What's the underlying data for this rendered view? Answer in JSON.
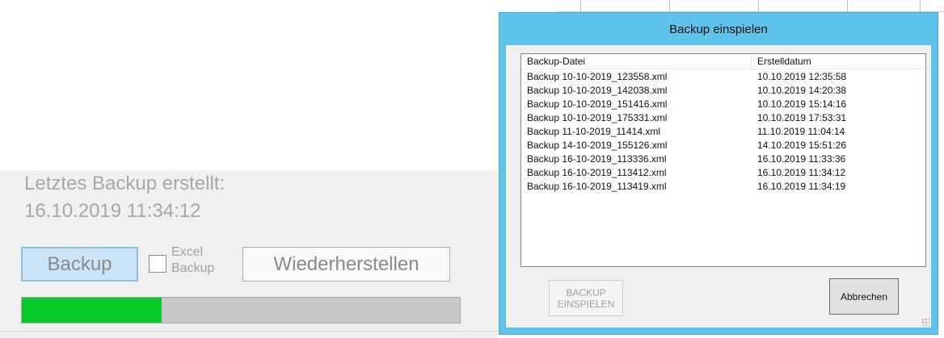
{
  "main": {
    "last_backup_label": "Letztes Backup erstellt:",
    "last_backup_time": "16.10.2019 11:34:12",
    "backup_button": "Backup",
    "excel_label": "Excel\nBackup",
    "excel_checked": false,
    "restore_button": "Wiederherstellen",
    "progress": 0.32,
    "progress_color": "#06cc2b"
  },
  "dialog": {
    "title": "Backup einspielen",
    "columns": [
      "Backup-Datei",
      "Erstelldatum"
    ],
    "rows": [
      {
        "file": "Backup 10-10-2019_123558.xml",
        "date": "10.10.2019 12:35:58"
      },
      {
        "file": "Backup 10-10-2019_142038.xml",
        "date": "10.10.2019 14:20:38"
      },
      {
        "file": "Backup 10-10-2019_151416.xml",
        "date": "10.10.2019 15:14:16"
      },
      {
        "file": "Backup 10-10-2019_175331.xml",
        "date": "10.10.2019 17:53:31"
      },
      {
        "file": "Backup 11-10-2019_11414.xml",
        "date": "11.10.2019 11:04:14"
      },
      {
        "file": "Backup 14-10-2019_155126.xml",
        "date": "14.10.2019 15:51:26"
      },
      {
        "file": "Backup 16-10-2019_113336.xml",
        "date": "16.10.2019 11:33:36"
      },
      {
        "file": "Backup 16-10-2019_113412.xml",
        "date": "16.10.2019 11:34:12"
      },
      {
        "file": "Backup 16-10-2019_113419.xml",
        "date": "16.10.2019 11:34:19"
      }
    ],
    "import_button": "BACKUP\nEINSPIELEN",
    "cancel_button": "Abbrechen",
    "title_bar_color": "#5ec3ea"
  }
}
